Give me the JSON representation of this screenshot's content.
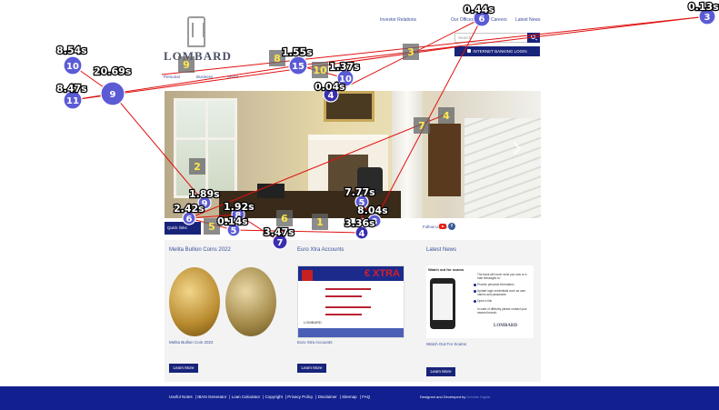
{
  "header": {
    "logo_text": "LOMBARD",
    "top_nav": [
      "Investor Relations",
      "Our Offices",
      "Careers",
      "Latest News"
    ],
    "search_placeholder": "Search...",
    "login_button": "INTERNET BANKING LOGIN",
    "main_nav": [
      "Personal",
      "Business",
      "About"
    ]
  },
  "quick_links": {
    "label": "Quick links",
    "follow_text": "Follow Us On:"
  },
  "cards": [
    {
      "title": "Melita Bullion Coins 2022",
      "caption": "Melita Bullion Coin 2022",
      "button": "Learn More"
    },
    {
      "title": "Euro Xtra Accounts",
      "caption": "Euro Xtra Accounts",
      "button": "Learn More",
      "flyer": {
        "brand_text": "XTRA",
        "currency": "€",
        "logo": "LOMBARD"
      }
    },
    {
      "title": "Latest News",
      "caption": "Watch Out For Scams",
      "button": "Learn More",
      "scam": {
        "heading": "Watch out for scams",
        "lines": [
          "The bank will never send you sms or e-mail messages to:",
          "Provide personal information",
          "Update login credentials such as user names and passwords",
          "Open a link",
          "In case of difficulty please contact your nearest branch."
        ],
        "logo": "LOMBARD"
      }
    }
  ],
  "footer": {
    "links": [
      "Useful Notes",
      "IBAN Generator",
      "Loan Calculator",
      "Copyright",
      "Privacy Policy",
      "Disclaimer",
      "Sitemap",
      "FAQ"
    ],
    "credit_prefix": "Designed and Developed by",
    "credit_brand": "Deloitte Digital"
  },
  "overlay": {
    "colors": {
      "circle": "#5b5bd6",
      "circle_dark": "#3a2fb0",
      "line": "#e01010",
      "square": "#666666",
      "square_text": "#ffe84a"
    },
    "circles": [
      {
        "label": "10",
        "time": "8.54s"
      },
      {
        "label": "9",
        "time": "20.69s"
      },
      {
        "label": "11",
        "time": "8.47s"
      },
      {
        "label": "15",
        "time": "1.55s"
      },
      {
        "label": "10",
        "time": "1.37s"
      },
      {
        "label": "4",
        "time": "0.04s"
      },
      {
        "label": "6",
        "time": "0.44s"
      },
      {
        "label": "3",
        "time": "0.13s"
      },
      {
        "label": "9",
        "time": "1.89s"
      },
      {
        "label": "6",
        "time": "2.42s"
      },
      {
        "label": "8",
        "time": "1.92s"
      },
      {
        "label": "5",
        "time": "0.14s"
      },
      {
        "label": "7",
        "time": "3.47s"
      },
      {
        "label": "5",
        "time": "7.77s"
      },
      {
        "label": "3",
        "time": "8.04s"
      },
      {
        "label": "4",
        "time": "3.36s"
      }
    ],
    "squares": [
      "9",
      "8",
      "10",
      "3",
      "7",
      "4",
      "2",
      "5",
      "6",
      "1"
    ]
  }
}
